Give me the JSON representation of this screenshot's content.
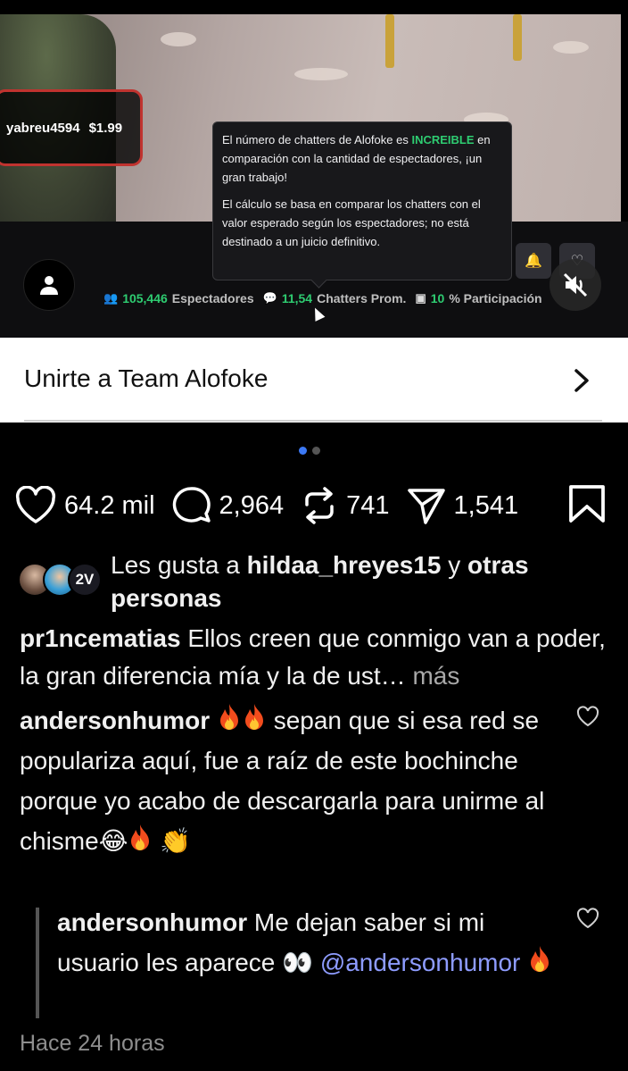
{
  "stream": {
    "donation_user": "yabreu4594",
    "donation_amount": "$1.99",
    "viewers_count": "105,446",
    "viewers_label": "Espectadores",
    "chatters_count": "11,54",
    "chatters_label": "Chatters Prom.",
    "participation_value": "10",
    "participation_label": "% Participación",
    "tooltip": {
      "line1_before": "El número de chatters de Alofoke es",
      "highlight": "INCREIBLE",
      "line1_after": " en comparación con la cantidad de espectadores, ¡un gran trabajo!",
      "paragraph2": "El cálculo se basa en comparar los chatters con el valor esperado según los espectadores; no está destinado a un juicio definitivo."
    }
  },
  "join": {
    "label": "Unirte a Team Alofoke"
  },
  "carousel": {
    "total": 2,
    "active": 1
  },
  "actions": {
    "likes": "64.2 mil",
    "comments": "2,964",
    "reposts": "741",
    "shares": "1,541"
  },
  "likes_summary": {
    "prefix": "Les gusta a ",
    "user": "hildaa_hreyes15",
    "suffix": " y ",
    "others": "otras personas"
  },
  "caption": {
    "user": "pr1ncematias",
    "text": " Ellos creen que conmigo van a poder, la gran diferencia mía y la de ust…",
    "more": " más"
  },
  "comment1": {
    "user": "andersonhumor",
    "text": " sepan que si esa red se populariza aquí, fue a raíz de este bochinche porque yo acabo de descargarla para unirme al chisme",
    "laugh_emoji": "😂",
    "clap_emoji": "👏"
  },
  "comment2": {
    "user": "andersonhumor",
    "text": " Me dejan saber si mi usuario les aparece ",
    "eyes_emoji": "👀",
    "mention": "@andersonhumor"
  },
  "timestamp": "Hace 24 horas",
  "colors": {
    "accent_green": "#2ecc71",
    "donation_border": "#c0332f",
    "dot_active": "#3c79f5",
    "mention": "#8e9cff"
  }
}
